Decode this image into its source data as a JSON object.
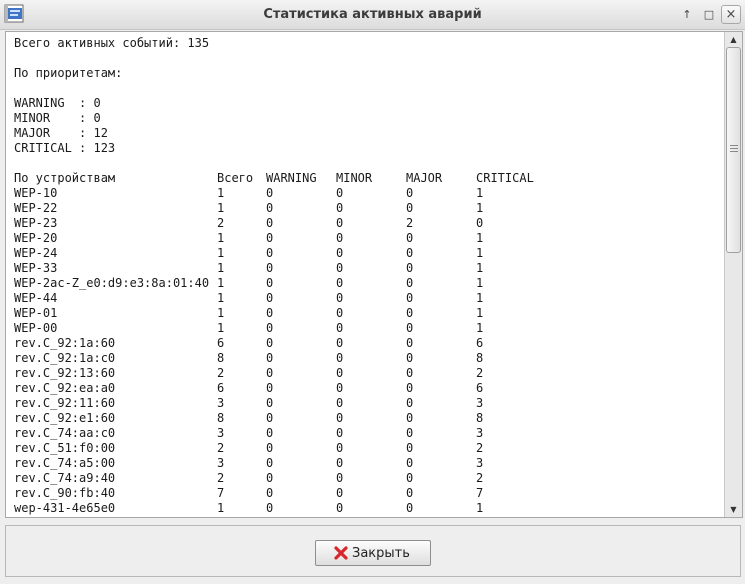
{
  "window": {
    "title": "Статистика активных аварий"
  },
  "summary": {
    "total_line": "Всего активных событий: 135",
    "priority_header": "По приоритетам:",
    "priorities": [
      "WARNING  : 0",
      "MINOR    : 0",
      "MAJOR    : 12",
      "CRITICAL : 123"
    ]
  },
  "devices": {
    "columns": [
      "По устройствам",
      "Всего",
      "WARNING",
      "MINOR",
      "MAJOR",
      "CRITICAL"
    ],
    "rows": [
      [
        "WEP-10",
        "1",
        "0",
        "0",
        "0",
        "1"
      ],
      [
        "WEP-22",
        "1",
        "0",
        "0",
        "0",
        "1"
      ],
      [
        "WEP-23",
        "2",
        "0",
        "0",
        "2",
        "0"
      ],
      [
        "WEP-20",
        "1",
        "0",
        "0",
        "0",
        "1"
      ],
      [
        "WEP-24",
        "1",
        "0",
        "0",
        "0",
        "1"
      ],
      [
        "WEP-33",
        "1",
        "0",
        "0",
        "0",
        "1"
      ],
      [
        "WEP-2ac-Z_e0:d9:e3:8a:01:40",
        "1",
        "0",
        "0",
        "0",
        "1"
      ],
      [
        "WEP-44",
        "1",
        "0",
        "0",
        "0",
        "1"
      ],
      [
        "WEP-01",
        "1",
        "0",
        "0",
        "0",
        "1"
      ],
      [
        "WEP-00",
        "1",
        "0",
        "0",
        "0",
        "1"
      ],
      [
        "rev.C_92:1a:60",
        "6",
        "0",
        "0",
        "0",
        "6"
      ],
      [
        "rev.C_92:1a:c0",
        "8",
        "0",
        "0",
        "0",
        "8"
      ],
      [
        "rev.C_92:13:60",
        "2",
        "0",
        "0",
        "0",
        "2"
      ],
      [
        "rev.C_92:ea:a0",
        "6",
        "0",
        "0",
        "0",
        "6"
      ],
      [
        "rev.C_92:11:60",
        "3",
        "0",
        "0",
        "0",
        "3"
      ],
      [
        "rev.C_92:e1:60",
        "8",
        "0",
        "0",
        "0",
        "8"
      ],
      [
        "rev.C_74:aa:c0",
        "3",
        "0",
        "0",
        "0",
        "3"
      ],
      [
        "rev.C_51:f0:00",
        "2",
        "0",
        "0",
        "0",
        "2"
      ],
      [
        "rev.C_74:a5:00",
        "3",
        "0",
        "0",
        "0",
        "3"
      ],
      [
        "rev.C_74:a9:40",
        "2",
        "0",
        "0",
        "0",
        "2"
      ],
      [
        "rev.C_90:fb:40",
        "7",
        "0",
        "0",
        "0",
        "7"
      ],
      [
        "wep-431-4e65e0",
        "1",
        "0",
        "0",
        "0",
        "1"
      ]
    ]
  },
  "buttons": {
    "close_label": "Закрыть"
  },
  "icons": {
    "app": "app-window-icon",
    "restore": "arrow-up-icon",
    "maximize": "maximize-icon",
    "close": "close-icon",
    "button": "red-x-icon"
  },
  "colors": {
    "close_icon": "#d9262b",
    "app_icon": "#3f74c7"
  }
}
